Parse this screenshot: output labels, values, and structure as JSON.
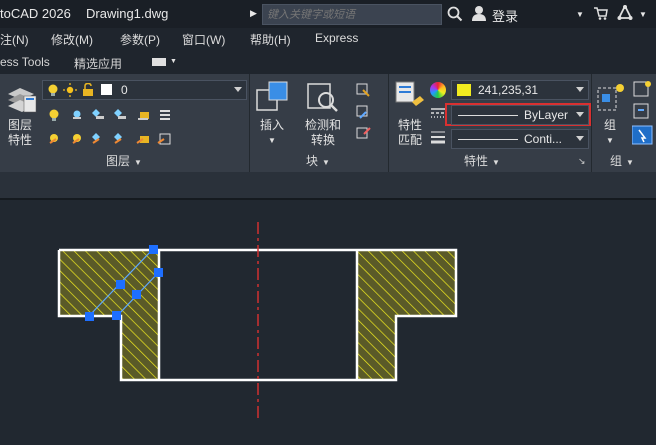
{
  "titlebar": {
    "app_name": "toCAD 2026",
    "doc_name": "Drawing1.dwg",
    "search_placeholder": "键入关键字或短语",
    "login_label": "登录"
  },
  "menubar": {
    "items": [
      "注(N)",
      "修改(M)",
      "参数(P)",
      "窗口(W)",
      "帮助(H)",
      "Express"
    ]
  },
  "tabstrip": {
    "tabs": [
      "ess Tools",
      "精选应用"
    ]
  },
  "ribbon": {
    "layer_panel": {
      "big_button_line1": "图层",
      "big_button_line2": "特性",
      "layer_value": "0",
      "panel_label": "图层"
    },
    "block_panel": {
      "insert_label": "插入",
      "detect_line1": "检测和",
      "detect_line2": "转换",
      "panel_label": "块"
    },
    "properties_panel": {
      "match_line1": "特性",
      "match_line2": "匹配",
      "color_value": "241,235,31",
      "linetype_value": "ByLayer",
      "lineweight_value": "Conti...",
      "panel_label": "特性"
    },
    "group_panel": {
      "group_label": "组",
      "panel_label": "组"
    }
  },
  "colors": {
    "accent_color": "#f1eb1f",
    "highlight_border": "#d93030",
    "grip_color": "#1e6fff"
  }
}
